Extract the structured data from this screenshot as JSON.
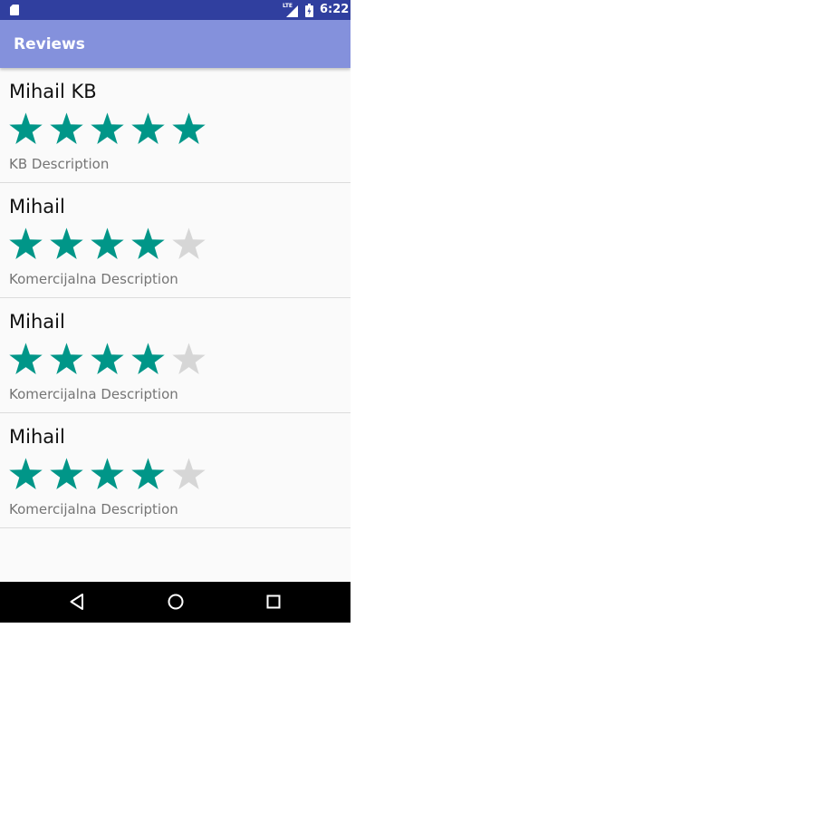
{
  "status_bar": {
    "network": "LTE",
    "time": "6:22",
    "icons": [
      "sd-card-icon",
      "signal-icon",
      "battery-icon"
    ]
  },
  "app_bar": {
    "title": "Reviews"
  },
  "reviews": [
    {
      "name": "Mihail KB",
      "rating": 5,
      "max_rating": 5,
      "description": "KB Description"
    },
    {
      "name": "Mihail",
      "rating": 4,
      "max_rating": 5,
      "description": "Komercijalna Description"
    },
    {
      "name": "Mihail",
      "rating": 4,
      "max_rating": 5,
      "description": "Komercijalna Description"
    },
    {
      "name": "Mihail",
      "rating": 4,
      "max_rating": 5,
      "description": "Komercijalna Description"
    }
  ],
  "nav_bar": {
    "buttons": [
      "back-icon",
      "home-icon",
      "recents-icon"
    ]
  },
  "colors": {
    "status_bar": "#303f9f",
    "app_bar": "#8491dc",
    "star_filled": "#009688",
    "star_empty": "#d6d6d6"
  }
}
